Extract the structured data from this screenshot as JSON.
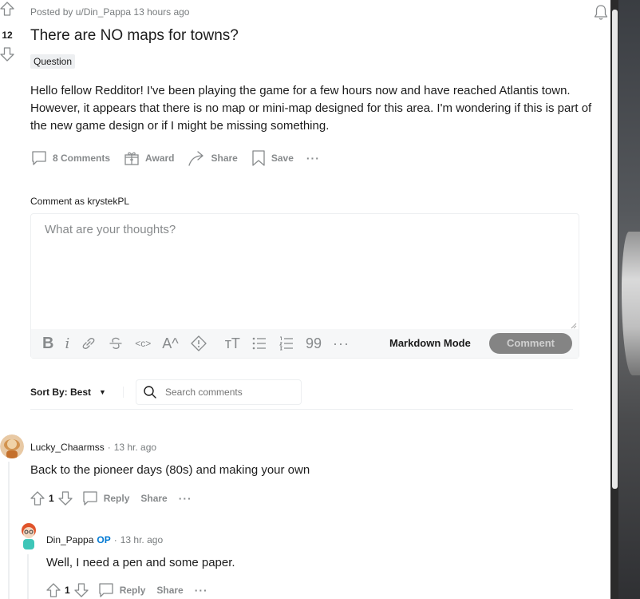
{
  "post": {
    "score": "12",
    "meta": "Posted by u/Din_Pappa 13 hours ago",
    "title": "There are NO maps for towns?",
    "flair": "Question",
    "body": "Hello fellow Redditor! I've been playing the game for a few hours now and have reached Atlantis town. However, it appears that there is no map or mini-map designed for this area. I'm wondering if this is part of the new game design or if I might be missing something.",
    "actions": {
      "comments": "8 Comments",
      "award": "Award",
      "share": "Share",
      "save": "Save",
      "more": "···"
    }
  },
  "composer": {
    "comment_as": "Comment as krystekPL",
    "placeholder": "What are your thoughts?",
    "toolbar": {
      "bold": "B",
      "italic": "i",
      "code": "<c>",
      "superscript": "A^",
      "heading": "тT",
      "quote": "99",
      "more": "···"
    },
    "markdown_mode": "Markdown Mode",
    "submit": "Comment"
  },
  "sort": {
    "label": "Sort By: Best",
    "caret": "▼",
    "search_placeholder": "Search comments"
  },
  "comments": [
    {
      "author": "Lucky_Chaarmss",
      "op": "",
      "time": "13 hr. ago",
      "text": "Back to the pioneer days (80s) and making your own",
      "score": "1",
      "reply": "Reply",
      "share": "Share",
      "more": "···"
    },
    {
      "author": "Din_Pappa",
      "op": "OP",
      "time": "13 hr. ago",
      "text": "Well, I need a pen and some paper.",
      "score": "1",
      "reply": "Reply",
      "share": "Share",
      "more": "···"
    }
  ],
  "separator": "·",
  "colors": {
    "meta_gray": "#787c7e",
    "action_gray": "#878a8c",
    "op_blue": "#0079d3",
    "button_gray": "#848484",
    "divider": "#edeff1"
  }
}
